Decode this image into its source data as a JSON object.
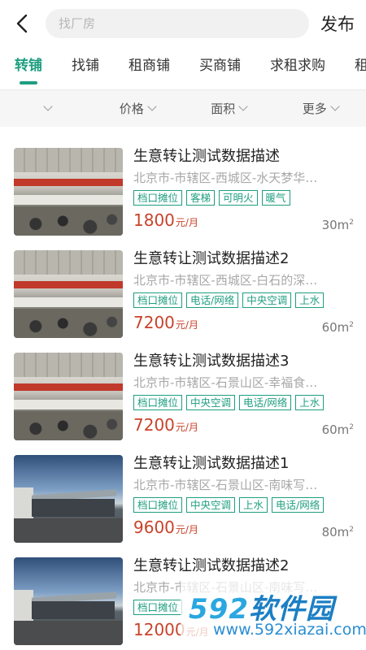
{
  "header": {
    "search_placeholder": "找厂房",
    "publish_label": "发布"
  },
  "tabs": [
    {
      "label": "转铺",
      "active": true
    },
    {
      "label": "找铺",
      "active": false
    },
    {
      "label": "租商铺",
      "active": false
    },
    {
      "label": "买商铺",
      "active": false
    },
    {
      "label": "求租求购",
      "active": false
    },
    {
      "label": "租",
      "active": false
    }
  ],
  "filters": [
    {
      "label": ""
    },
    {
      "label": "价格"
    },
    {
      "label": "面积"
    },
    {
      "label": "更多"
    }
  ],
  "listings": [
    {
      "title": "生意转让测试数据描述",
      "address": "北京市-市辖区-西城区-水天梦华…",
      "tags": [
        "档口摊位",
        "客梯",
        "可明火",
        "暖气"
      ],
      "price": "1800",
      "price_unit": "元/月",
      "area": "30m",
      "area_sup": "2",
      "image": "room"
    },
    {
      "title": "生意转让测试数据描述2",
      "address": "北京市-市辖区-西城区-白石的深…",
      "tags": [
        "档口摊位",
        "电话/网络",
        "中央空调",
        "上水"
      ],
      "price": "7200",
      "price_unit": "元/月",
      "area": "60m",
      "area_sup": "2",
      "image": "room"
    },
    {
      "title": "生意转让测试数据描述3",
      "address": "北京市-市辖区-石景山区-幸福食…",
      "tags": [
        "档口摊位",
        "中央空调",
        "电话/网络",
        "上水"
      ],
      "price": "7200",
      "price_unit": "元/月",
      "area": "60m",
      "area_sup": "2",
      "image": "room"
    },
    {
      "title": "生意转让测试数据描述1",
      "address": "北京市-市辖区-石景山区-南味写…",
      "tags": [
        "档口摊位",
        "中央空调",
        "上水",
        "电话/网络"
      ],
      "price": "9600",
      "price_unit": "元/月",
      "area": "80m",
      "area_sup": "2",
      "image": "yard"
    },
    {
      "title": "生意转让测试数据描述2",
      "address": "北京市-市辖区-石景山区-南味写…",
      "tags": [
        "档口摊位"
      ],
      "price": "12000",
      "price_unit": "元/月",
      "area": "",
      "area_sup": "",
      "image": "yard"
    }
  ],
  "watermark": {
    "logo_num": "592",
    "logo_cn": "软件园",
    "site": "www.592xiazai.com"
  },
  "colors": {
    "accent": "#1e9e80",
    "price": "#c8432a"
  },
  "icons": {
    "back": "back-arrow-icon",
    "dropdown": "chevron-down-icon"
  }
}
